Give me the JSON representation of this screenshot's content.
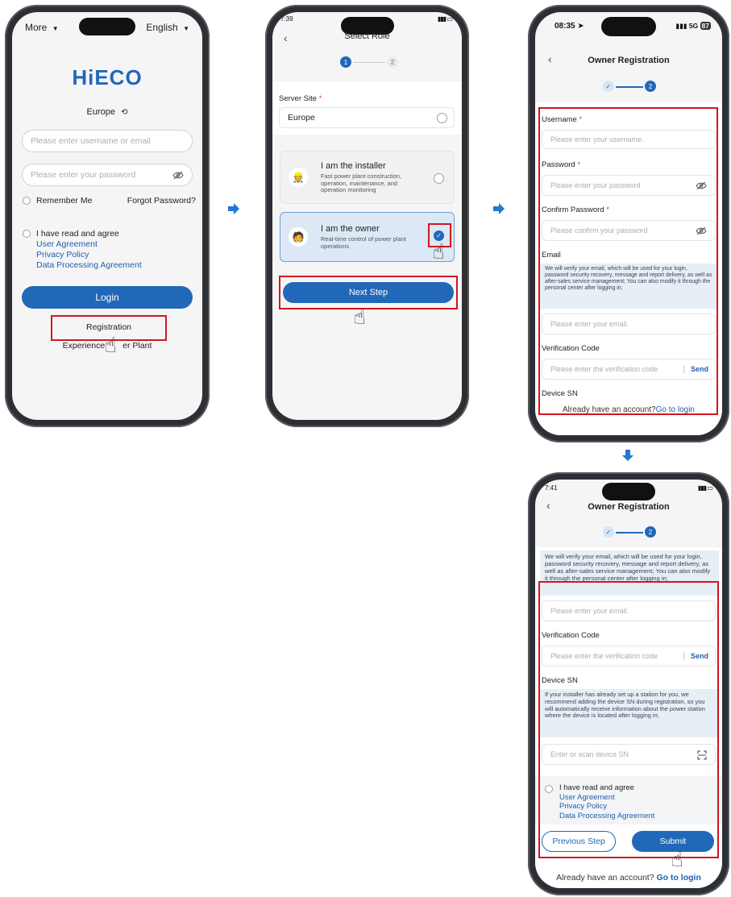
{
  "phone1": {
    "more_label": "More",
    "language": "English",
    "logo": "HiECO",
    "region": "Europe",
    "username_placeholder": "Please enter username or email",
    "password_placeholder": "Please enter your password",
    "remember_me": "Remember Me",
    "forgot_password": "Forgot Password?",
    "agree_text": "I have read and agree",
    "user_agreement": "User Agreement",
    "privacy_policy": "Privacy Policy",
    "data_processing": "Data Processing Agreement",
    "login_label": "Login",
    "registration_label": "Registration",
    "experience_left": "Experience",
    "experience_right": "er Plant"
  },
  "phone2": {
    "time": "7:39",
    "title": "Select Role",
    "step1": "1",
    "step2": "2",
    "server_site_label": "Server Site",
    "server_site_value": "Europe",
    "installer_title": "I am the installer",
    "installer_desc": "Fast power plant construction, operation, maintenance, and operation monitoring",
    "owner_title": "I am the owner",
    "owner_desc": "Real-time control of power plant operations",
    "next_step_label": "Next Step"
  },
  "phone3": {
    "time": "08:35",
    "signal": "5G",
    "battery": "87",
    "title": "Owner Registration",
    "step2": "2",
    "username_label": "Username",
    "username_placeholder": "Please enter your username.",
    "password_label": "Password",
    "password_placeholder": "Please enter your password",
    "confirm_label": "Confirm Password",
    "confirm_placeholder": "Please confirm your password",
    "email_label": "Email",
    "email_note": "We will verify your email, which will be used for your login, password security recovery, message and report delivery, as well as after-sales service management; You can also modify it through the personal center after logging in;",
    "email_placeholder": "Please enter your email.",
    "code_label": "Verification Code",
    "code_placeholder": "Please enter the verification code",
    "send_label": "Send",
    "device_label": "Device SN",
    "already_text": "Already have an account?",
    "go_login": "Go to login"
  },
  "phone4": {
    "time": "7:41",
    "title": "Owner Registration",
    "step2": "2",
    "email_note": "We will verify your email, which will be used for your login, password security recovery, message and report delivery, as well as after-sales service management; You can also modify it through the personal center after logging in;",
    "email_placeholder": "Please enter your email.",
    "code_label": "Verification Code",
    "code_placeholder": "Please enter the verification code",
    "send_label": "Send",
    "device_label": "Device SN",
    "device_note": "If your installer has already set up a station for you, we recommend adding the device SN during registration, so you will automatically receive information about the power station where the device is located after logging in;",
    "device_placeholder": "Enter or scan device SN",
    "agree_text": "I have read and agree",
    "user_agreement": "User Agreement",
    "privacy_policy": "Privacy Policy",
    "data_processing": "Data Processing Agreement",
    "previous_label": "Previous Step",
    "submit_label": "Submit",
    "already_text": "Already have an account?",
    "go_login": "Go to login"
  },
  "colors": {
    "brand_blue": "#2268b8",
    "highlight_red": "#d4151f",
    "arrow_blue": "#1f78d1"
  }
}
